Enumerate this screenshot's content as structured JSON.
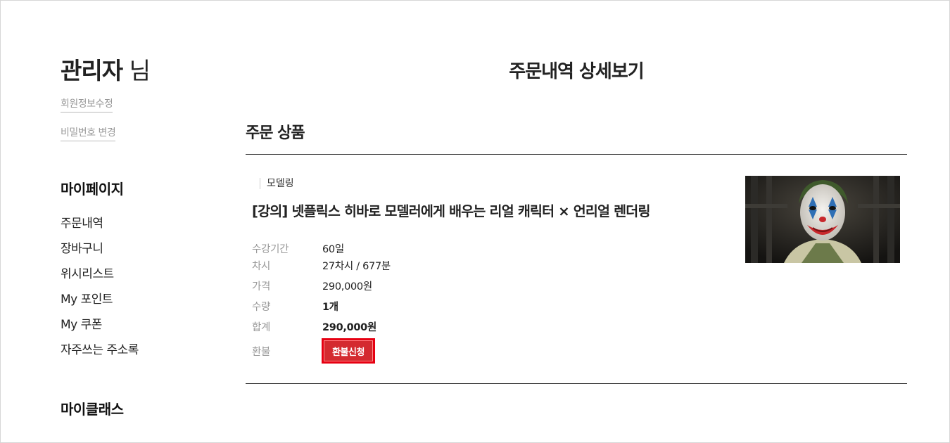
{
  "sidebar": {
    "greeting_name": "관리자",
    "greeting_suffix": " 님",
    "edit_profile": "회원정보수정",
    "change_password": "비밀번호 변경",
    "mypage_heading": "마이페이지",
    "menu": [
      {
        "label": "주문내역"
      },
      {
        "label": "장바구니"
      },
      {
        "label": "위시리스트"
      },
      {
        "label": "My 포인트"
      },
      {
        "label": "My 쿠폰"
      },
      {
        "label": "자주쓰는 주소록"
      }
    ],
    "myclass_heading": "마이클래스"
  },
  "main": {
    "page_title": "주문내역 상세보기",
    "section_title": "주문 상품",
    "product": {
      "category": "모델링",
      "title": "[강의] 넷플릭스 히바로 모델러에게 배우는 리얼 캐릭터 × 언리얼 렌더링",
      "details": {
        "period_label": "수강기간",
        "period_value": "60일",
        "session_label": "차시",
        "session_value": "27차시 / 677분",
        "price_label": "가격",
        "price_value": "290,000원",
        "qty_label": "수량",
        "qty_value": "1개",
        "total_label": "합계",
        "total_value": "290,000원",
        "refund_label": "환불",
        "refund_button": "환불신청"
      }
    }
  },
  "colors": {
    "refund_button_bg": "#d42a2f",
    "refund_button_border": "#e60012",
    "label_gray": "#999999",
    "text_dark": "#222222"
  },
  "icons": {
    "thumbnail": "joker-character-thumbnail"
  }
}
